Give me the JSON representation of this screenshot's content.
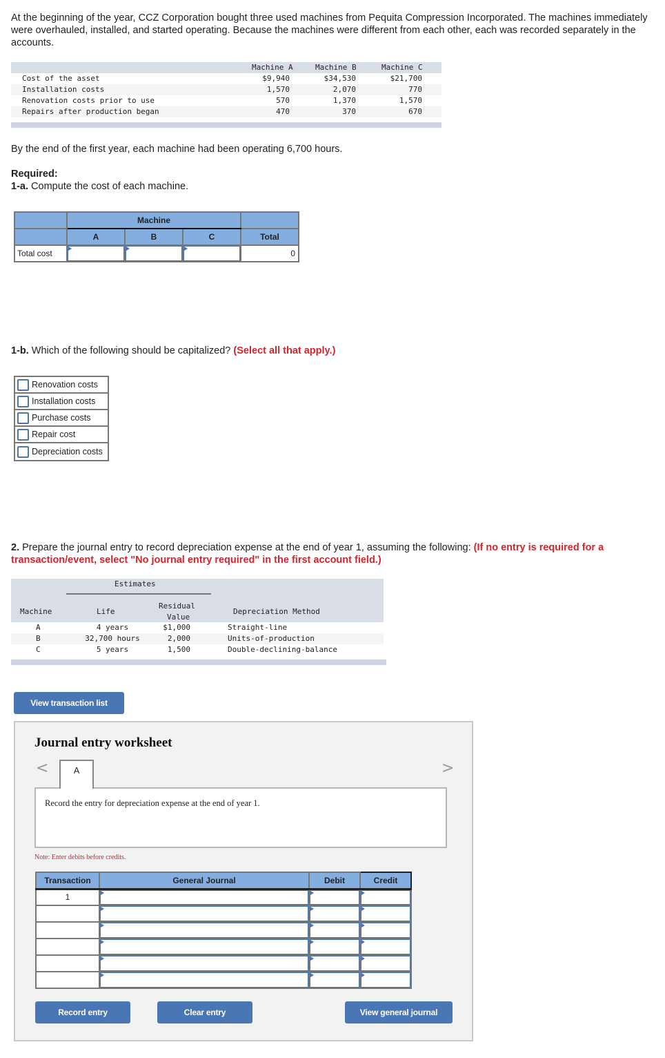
{
  "intro": "At the beginning of the year, CCZ Corporation bought three used machines from Pequita Compression Incorporated. The machines immediately were overhauled, installed, and started operating. Because the machines were different from each other, each was recorded separately in the accounts.",
  "given_table": {
    "headers": [
      "Machine A",
      "Machine B",
      "Machine C"
    ],
    "rows": [
      {
        "label": "Cost of the asset",
        "values": [
          "$9,940",
          "$34,530",
          "$21,700"
        ]
      },
      {
        "label": "Installation costs",
        "values": [
          "1,570",
          "2,070",
          "770"
        ]
      },
      {
        "label": "Renovation costs prior to use",
        "values": [
          "570",
          "1,370",
          "1,570"
        ]
      },
      {
        "label": "Repairs after production began",
        "values": [
          "470",
          "370",
          "670"
        ]
      }
    ]
  },
  "hours_text": "By the end of the first year, each machine had been operating 6,700 hours.",
  "required_label": "Required:",
  "q1a": {
    "num": "1-a.",
    "text": " Compute the cost of each machine."
  },
  "cost_table": {
    "group_header": "Machine",
    "columns": [
      "A",
      "B",
      "C"
    ],
    "total_header": "Total",
    "row_label": "Total cost",
    "values": [
      "",
      "",
      ""
    ],
    "total_value": "0"
  },
  "q1b": {
    "num": "1-b.",
    "text": " Which of the following should be capitalized? ",
    "instruction": "(Select all that apply.)"
  },
  "checkbox_options": [
    {
      "label": "Renovation costs",
      "checked": false
    },
    {
      "label": "Installation costs",
      "checked": false
    },
    {
      "label": "Purchase costs",
      "checked": false
    },
    {
      "label": "Repair cost",
      "checked": false
    },
    {
      "label": "Depreciation costs",
      "checked": false
    }
  ],
  "q2": {
    "num": "2.",
    "text": " Prepare the journal entry to record depreciation expense at the end of year 1, assuming the following: ",
    "instruction": "(If no entry is required for a transaction/event, select \"No journal entry required\" in the first account field.)"
  },
  "estimates_table": {
    "group_header": "Estimates",
    "headers": {
      "machine": "Machine",
      "life": "Life",
      "residual_1": "Residual",
      "residual_2": "Value",
      "method": "Depreciation Method"
    },
    "rows": [
      {
        "machine": "A",
        "life": "4 years",
        "residual": "$1,000",
        "method": "Straight-line"
      },
      {
        "machine": "B",
        "life": "32,700 hours",
        "residual": "2,000",
        "method": "Units-of-production"
      },
      {
        "machine": "C",
        "life": "5 years",
        "residual": "1,500",
        "method": "Double-declining-balance"
      }
    ]
  },
  "view_transaction_list": "View transaction list",
  "worksheet": {
    "title": "Journal entry worksheet",
    "prev": "<",
    "next": ">",
    "active_tab": "A",
    "description": "Record the entry for depreciation expense at the end of year 1.",
    "note": "Note: Enter debits before credits.",
    "columns": [
      "Transaction",
      "General Journal",
      "Debit",
      "Credit"
    ],
    "rows": [
      {
        "transaction": "1",
        "account": "",
        "debit": "",
        "credit": ""
      },
      {
        "transaction": "",
        "account": "",
        "debit": "",
        "credit": ""
      },
      {
        "transaction": "",
        "account": "",
        "debit": "",
        "credit": ""
      },
      {
        "transaction": "",
        "account": "",
        "debit": "",
        "credit": ""
      },
      {
        "transaction": "",
        "account": "",
        "debit": "",
        "credit": ""
      },
      {
        "transaction": "",
        "account": "",
        "debit": "",
        "credit": ""
      }
    ],
    "buttons": {
      "record": "Record entry",
      "clear": "Clear entry",
      "view_journal": "View general journal"
    }
  },
  "colors": {
    "button": "#4a76b3",
    "header_blue": "#84aee0",
    "instruction_red": "#d8232a",
    "note_red": "#a8323a"
  }
}
